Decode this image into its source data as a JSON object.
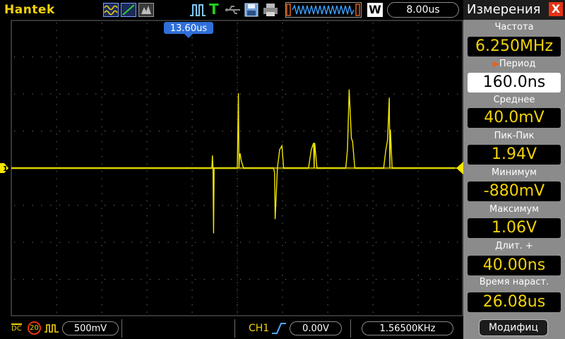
{
  "topbar": {
    "brand": "Hantek",
    "icons": [
      "wave-mode-icon",
      "line-mode-icon",
      "persist-icon",
      "trigger-state-icon",
      "trigger-t-icon",
      "usb-icon",
      "save-icon",
      "print-icon",
      "memory-waveform-icon"
    ],
    "trigger_state": "T",
    "mode_letter": "W",
    "time_per_div": "8.00us"
  },
  "scope": {
    "trigger_position_label": "13.60us",
    "channel_marker": "1",
    "colors": {
      "trace": "#f2e600",
      "grid": "#6a6a6a",
      "background": "#000000"
    }
  },
  "chart_data": {
    "type": "line",
    "title": "",
    "xlabel": "",
    "ylabel": "",
    "xlim": [
      -40,
      40
    ],
    "ylim": [
      -2000,
      2000
    ],
    "x_unit": "us",
    "y_unit": "mV",
    "series": [
      {
        "x": [
          -40,
          -4.5,
          -4.4,
          -4.3,
          -4.2,
          -4.1,
          -4.0,
          0,
          0.2,
          0.3,
          0.4,
          0.5,
          0.7,
          1.1,
          6.4,
          6.6,
          6.7,
          7.1,
          7.5,
          7.9,
          8.2,
          12.6,
          13.1,
          13.5,
          13.6,
          13.7,
          14.1,
          19.2,
          19.5,
          19.8,
          20.2,
          20.4,
          20.8,
          25.9,
          26.3,
          26.6,
          26.9,
          27.0,
          27.1,
          27.4,
          40
        ],
        "y": [
          0,
          0,
          170,
          0,
          -880,
          0,
          0,
          0,
          1010,
          0,
          160,
          200,
          100,
          0,
          0,
          -60,
          -690,
          0,
          250,
          300,
          0,
          0,
          250,
          340,
          0,
          340,
          0,
          0,
          250,
          1060,
          400,
          360,
          0,
          0,
          250,
          380,
          950,
          0,
          520,
          0,
          0
        ]
      }
    ]
  },
  "bottombar": {
    "coupling": "DC",
    "bw_limit": "20",
    "ch_volts": "500mV",
    "trigger_source": "CH1",
    "trigger_level": "0.00V",
    "trigger_frequency": "1.56500KHz"
  },
  "panel": {
    "title": "Измерения",
    "close_glyph": "X",
    "measurements": [
      {
        "label": "Частота",
        "value": "6.250MHz"
      },
      {
        "label": "Период",
        "value": "160.0ns",
        "selected": true
      },
      {
        "label": "Среднее",
        "value": "40.0mV"
      },
      {
        "label": "Пик-Пик",
        "value": "1.94V"
      },
      {
        "label": "Минимум",
        "value": "-880mV"
      },
      {
        "label": "Максимум",
        "value": "1.06V"
      },
      {
        "label": "Длит. +",
        "value": "40.00ns"
      },
      {
        "label": "Время нараст.",
        "value": "26.08us"
      }
    ],
    "modify_label": "Модифиц"
  }
}
